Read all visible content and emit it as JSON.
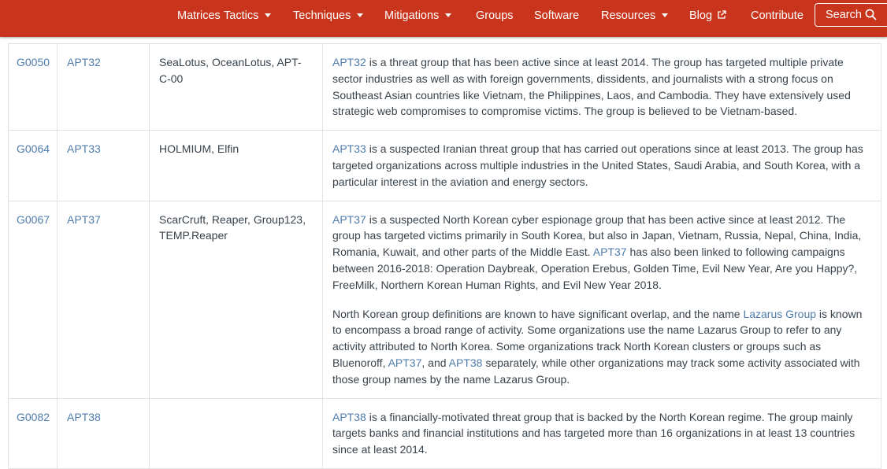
{
  "nav": {
    "matrices": "Matrices",
    "tactics": "Tactics",
    "techniques": "Techniques",
    "mitigations": "Mitigations",
    "groups": "Groups",
    "software": "Software",
    "resources": "Resources",
    "blog": "Blog",
    "contribute": "Contribute",
    "search": "Search"
  },
  "colors": {
    "nav_bg": "#c8351c",
    "link": "#4f7cac",
    "text": "#39434c",
    "border": "#e2e2e2"
  },
  "rows": [
    {
      "id": "G0050",
      "name": "APT32",
      "aliases": "SeaLotus, OceanLotus, APT-C-00",
      "p1": [
        {
          "t": "APT32",
          "link": true
        },
        {
          "t": " is a threat group that has been active since at least 2014. The group has targeted multiple private sector industries as well as with foreign governments, dissidents, and journalists with a strong focus on Southeast Asian countries like Vietnam, the Philippines, Laos, and Cambodia. They have extensively used strategic web compromises to compromise victims. The group is believed to be Vietnam-based.",
          "link": false
        }
      ]
    },
    {
      "id": "G0064",
      "name": "APT33",
      "aliases": "HOLMIUM, Elfin",
      "p1": [
        {
          "t": "APT33",
          "link": true
        },
        {
          "t": " is a suspected Iranian threat group that has carried out operations since at least 2013. The group has targeted organizations across multiple industries in the United States, Saudi Arabia, and South Korea, with a particular interest in the aviation and energy sectors.",
          "link": false
        }
      ]
    },
    {
      "id": "G0067",
      "name": "APT37",
      "aliases": "ScarCruft, Reaper, Group123, TEMP.Reaper",
      "p1": [
        {
          "t": "APT37",
          "link": true
        },
        {
          "t": " is a suspected North Korean cyber espionage group that has been active since at least 2012. The group has targeted victims primarily in South Korea, but also in Japan, Vietnam, Russia, Nepal, China, India, Romania, Kuwait, and other parts of the Middle East. ",
          "link": false
        },
        {
          "t": "APT37",
          "link": true
        },
        {
          "t": " has also been linked to following campaigns between 2016-2018: Operation Daybreak, Operation Erebus, Golden Time, Evil New Year, Are you Happy?, FreeMilk, Northern Korean Human Rights, and Evil New Year 2018.",
          "link": false
        }
      ],
      "p2": [
        {
          "t": "North Korean group definitions are known to have significant overlap, and the name ",
          "link": false
        },
        {
          "t": "Lazarus Group",
          "link": true
        },
        {
          "t": " is known to encompass a broad range of activity. Some organizations use the name Lazarus Group to refer to any activity attributed to North Korea. Some organizations track North Korean clusters or groups such as Bluenoroff, ",
          "link": false
        },
        {
          "t": "APT37",
          "link": true
        },
        {
          "t": ", and ",
          "link": false
        },
        {
          "t": "APT38",
          "link": true
        },
        {
          "t": " separately, while other organizations may track some activity associated with those group names by the name Lazarus Group.",
          "link": false
        }
      ]
    },
    {
      "id": "G0082",
      "name": "APT38",
      "aliases": "",
      "p1": [
        {
          "t": "APT38",
          "link": true
        },
        {
          "t": " is a financially-motivated threat group that is backed by the North Korean regime. The group mainly targets banks and financial institutions and has targeted more than 16 organizations in at least 13 countries since at least 2014.",
          "link": false
        }
      ]
    }
  ]
}
